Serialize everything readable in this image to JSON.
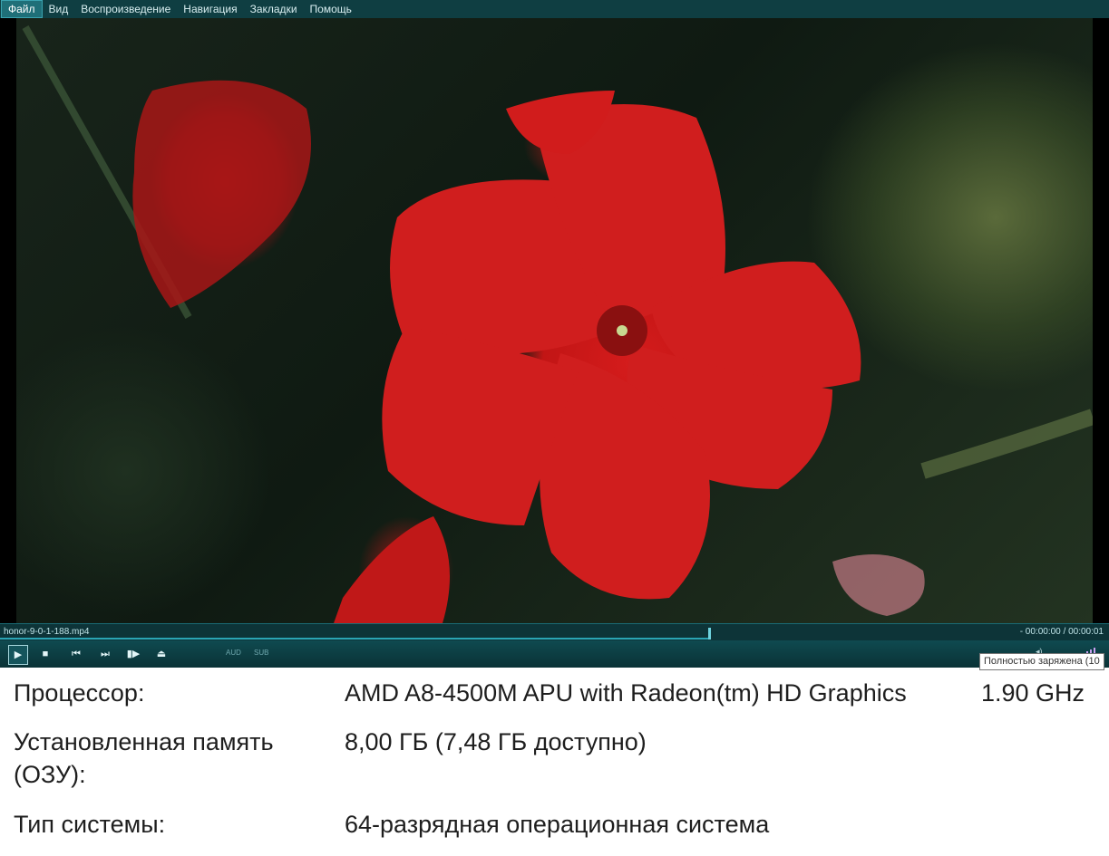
{
  "menu": {
    "items": [
      {
        "label": "Файл",
        "active": true
      },
      {
        "label": "Вид"
      },
      {
        "label": "Воспроизведение"
      },
      {
        "label": "Навигация"
      },
      {
        "label": "Закладки"
      },
      {
        "label": "Помощь"
      }
    ]
  },
  "player": {
    "filename": "honor-9-0-1-188.mp4",
    "time": "- 00:00:00 / 00:00:01",
    "progress": 0.64,
    "audio_label": "AUD",
    "subtitle_label": "SUB",
    "controls": [
      {
        "name": "play-button",
        "icon": "play-icon",
        "glyph": "▶"
      },
      {
        "name": "stop-button",
        "icon": "stop-icon",
        "glyph": "■"
      },
      {
        "name": "previous-button",
        "icon": "skip-back-icon",
        "glyph": "⏮"
      },
      {
        "name": "next-button",
        "icon": "skip-forward-icon",
        "glyph": "⏭"
      },
      {
        "name": "frame-step-button",
        "icon": "frame-step-icon",
        "glyph": "▮▶"
      },
      {
        "name": "eject-button",
        "icon": "eject-icon",
        "glyph": "⏏"
      }
    ],
    "accent_color": "#2aa4b4",
    "background_color": "#0b3b3f"
  },
  "tray": {
    "tooltip": "Полностью заряжена (10"
  },
  "system_info": {
    "processor_label": "Процессор:",
    "processor_value": "AMD A8-4500M APU with Radeon(tm) HD Graphics",
    "processor_speed": "1.90 GHz",
    "memory_label_line1": "Установленная память",
    "memory_label_line2": "(ОЗУ):",
    "memory_value": "8,00 ГБ (7,48 ГБ доступно)",
    "system_type_label": "Тип системы:",
    "system_type_value": "64-разрядная операционная система"
  }
}
